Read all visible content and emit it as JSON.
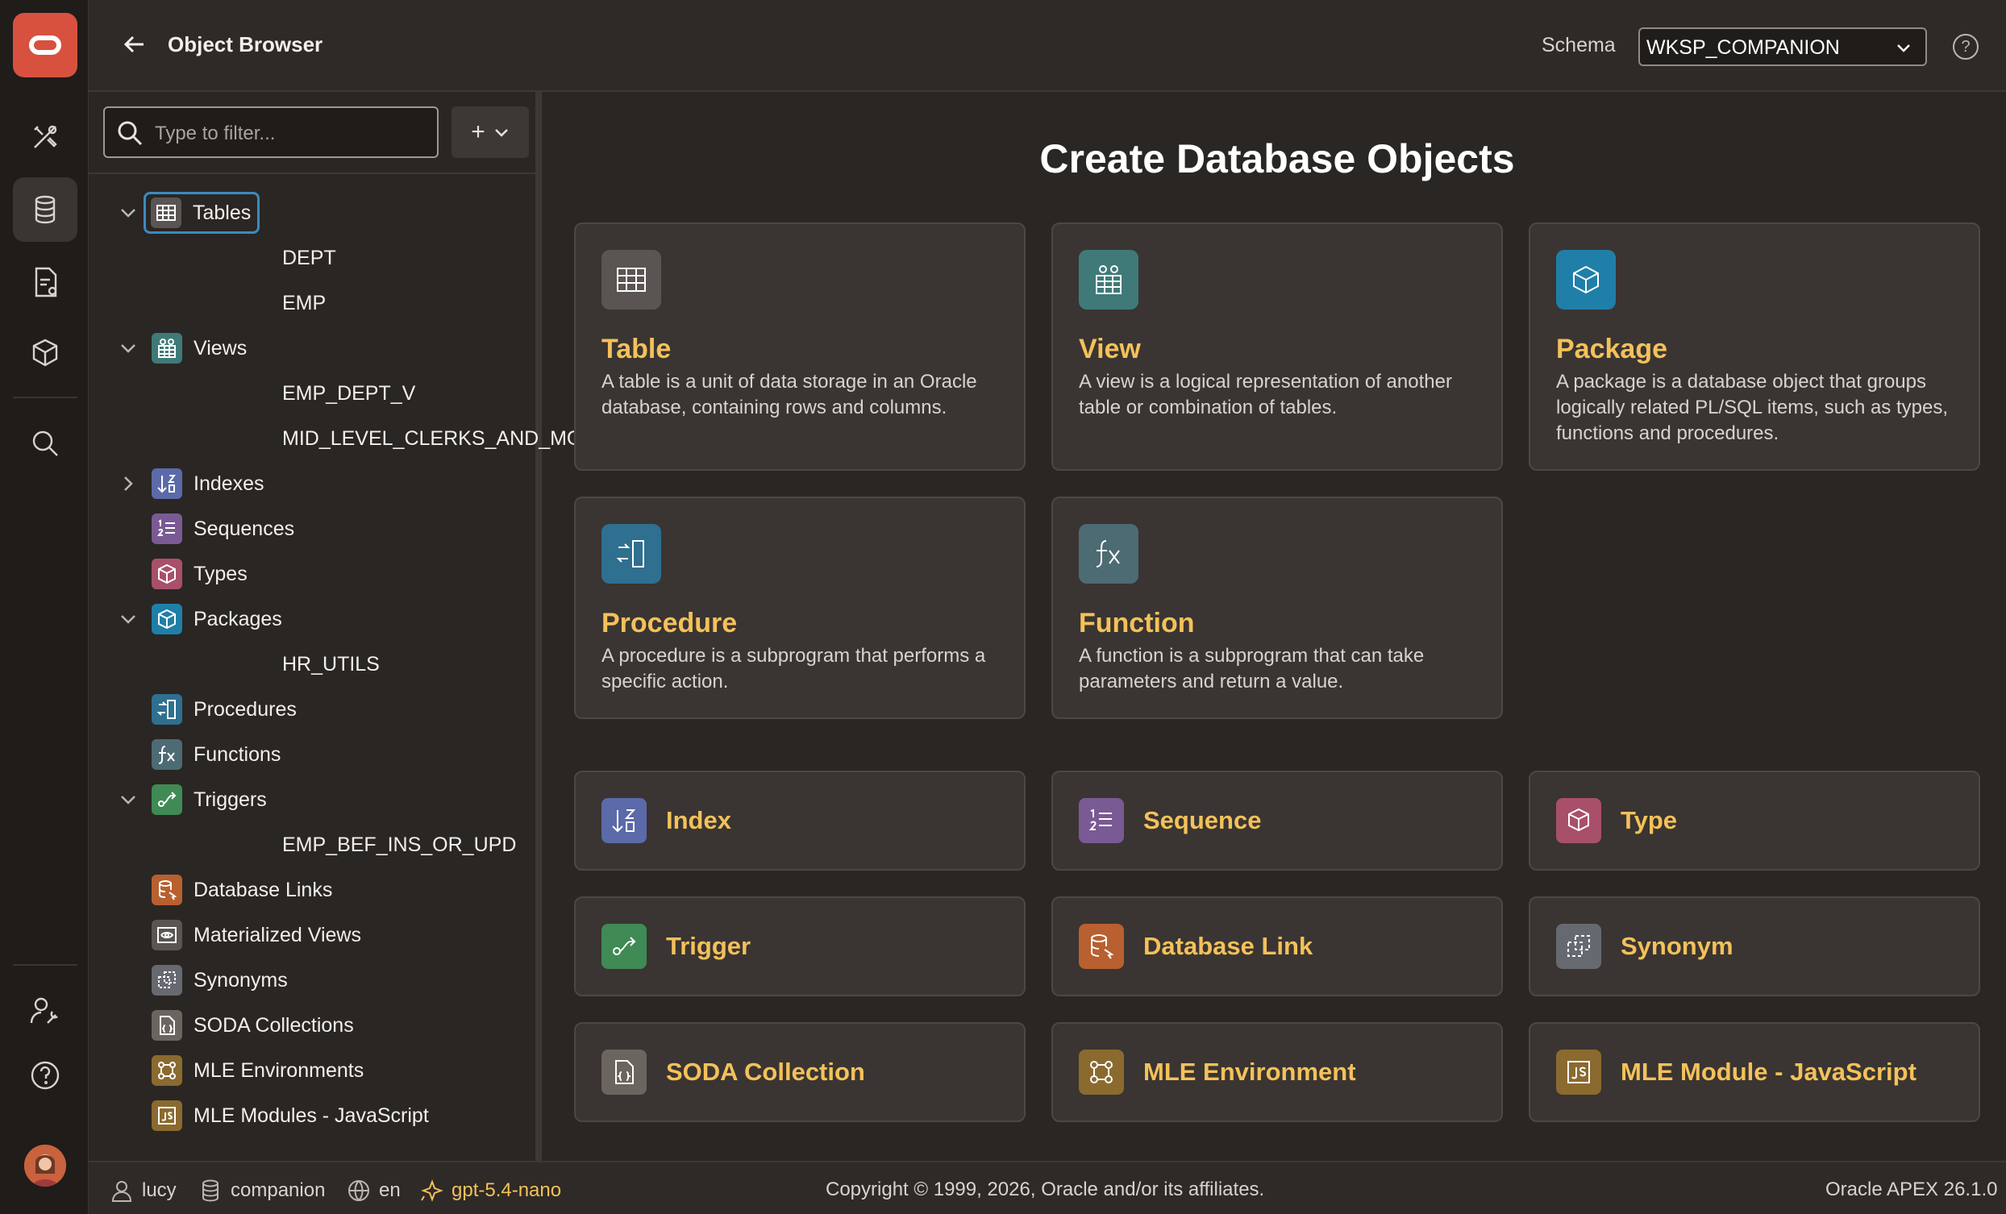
{
  "header": {
    "back_label": "Back",
    "title": "Object Browser",
    "schema_label": "Schema",
    "schema_value": "WKSP_COMPANION",
    "help_label": "?"
  },
  "filter": {
    "placeholder": "Type to filter...",
    "add_label": "+"
  },
  "tree": {
    "tables": "Tables",
    "dept": "DEPT",
    "emp": "EMP",
    "views": "Views",
    "emp_dept_v": "EMP_DEPT_V",
    "mid_level": "MID_LEVEL_CLERKS_AND_MGRS",
    "indexes": "Indexes",
    "sequences": "Sequences",
    "types": "Types",
    "packages": "Packages",
    "hr_utils": "HR_UTILS",
    "procedures": "Procedures",
    "functions": "Functions",
    "triggers": "Triggers",
    "emp_bef": "EMP_BEF_INS_OR_UPD",
    "db_links": "Database Links",
    "mviews": "Materialized Views",
    "synonyms": "Synonyms",
    "soda": "SODA Collections",
    "mle_env": "MLE Environments",
    "mle_mod": "MLE Modules - JavaScript"
  },
  "main": {
    "heading": "Create Database Objects",
    "cards": {
      "table": {
        "title": "Table",
        "desc": "A table is a unit of data storage in an Oracle database, containing rows and columns."
      },
      "view": {
        "title": "View",
        "desc": "A view is a logical representation of another table or combination of tables."
      },
      "package": {
        "title": "Package",
        "desc": "A package is a database object that groups logically related PL/SQL items, such as types, functions and procedures."
      },
      "procedure": {
        "title": "Procedure",
        "desc": "A procedure is a subprogram that performs a specific action."
      },
      "function": {
        "title": "Function",
        "desc": "A function is a subprogram that can take parameters and return a value."
      }
    },
    "tiles": {
      "index": "Index",
      "sequence": "Sequence",
      "type": "Type",
      "trigger": "Trigger",
      "dblink": "Database Link",
      "synonym": "Synonym",
      "soda": "SODA Collection",
      "mle_env": "MLE Environment",
      "mle_mod": "MLE Module - JavaScript"
    }
  },
  "footer": {
    "user": "lucy",
    "workspace": "companion",
    "language": "en",
    "ai_model": "gpt-5.4-nano",
    "copyright": "Copyright © 1999, 2026, Oracle and/or its affiliates.",
    "version": "Oracle APEX 26.1.0"
  },
  "colors": {
    "accent": "#f4c15a",
    "table_icon": "#5a5552",
    "view_icon": "#3f7a78",
    "package_icon": "#1f7fa8",
    "procedure_icon": "#2f6f8f",
    "function_icon": "#4d6b73",
    "index_icon": "#5b6aa8",
    "sequence_icon": "#7a5a94",
    "type_icon": "#a8506a",
    "trigger_icon": "#3f8a55",
    "dblink_icon": "#b8602f",
    "synonym_icon": "#666a70",
    "soda_icon": "#6b6560",
    "mle_icon": "#8a6a2f"
  }
}
